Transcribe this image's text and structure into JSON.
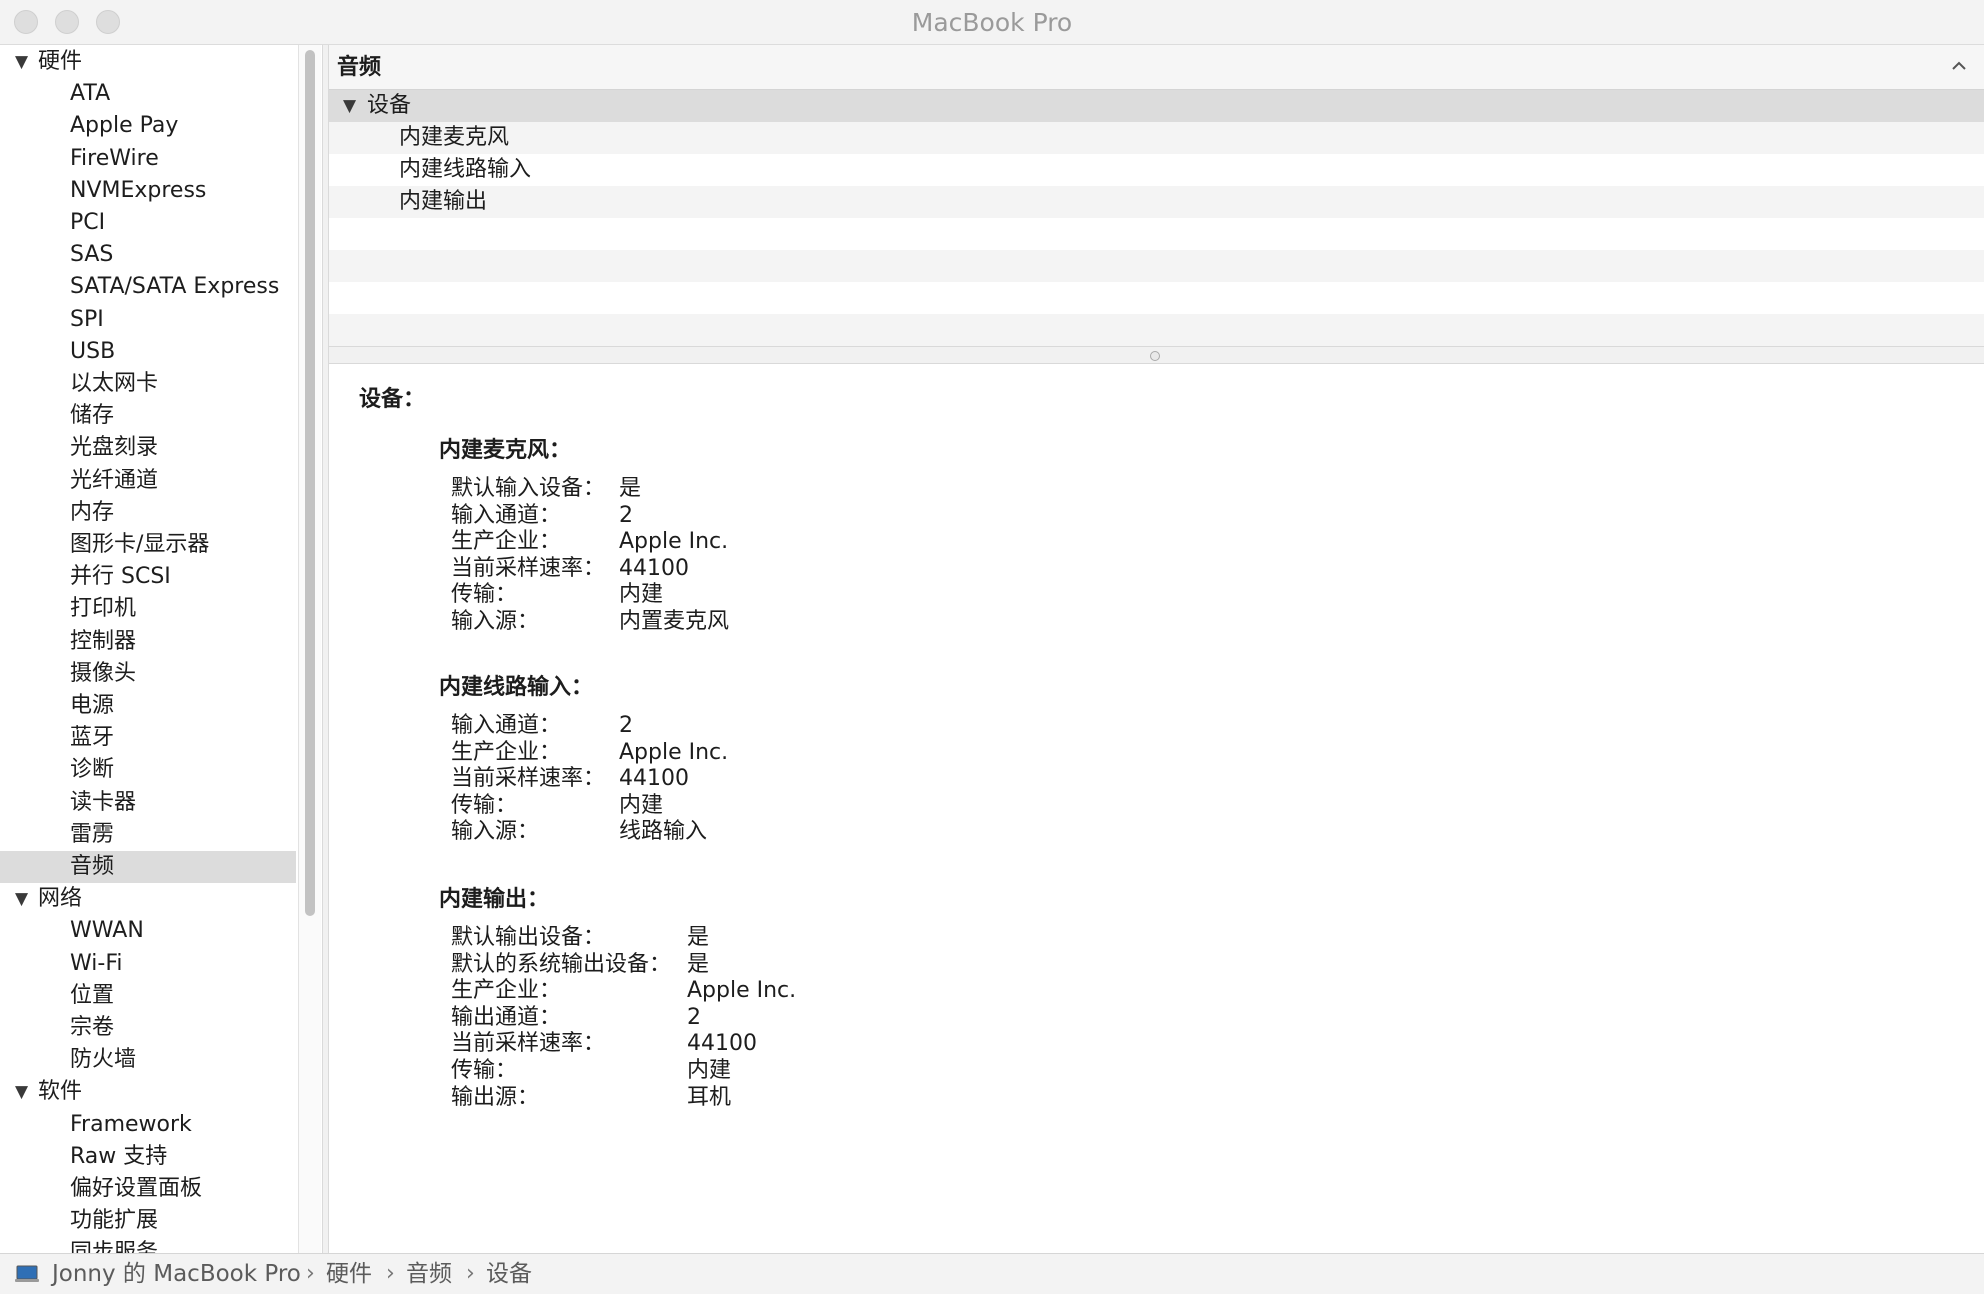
{
  "window": {
    "title": "MacBook Pro"
  },
  "sidebar": {
    "hardware": {
      "label": "硬件",
      "items": [
        "ATA",
        "Apple Pay",
        "FireWire",
        "NVMExpress",
        "PCI",
        "SAS",
        "SATA/SATA Express",
        "SPI",
        "USB",
        "以太网卡",
        "储存",
        "光盘刻录",
        "光纤通道",
        "内存",
        "图形卡/显示器",
        "并行 SCSI",
        "打印机",
        "控制器",
        "摄像头",
        "电源",
        "蓝牙",
        "诊断",
        "读卡器",
        "雷雳",
        "音频"
      ]
    },
    "network": {
      "label": "网络",
      "items": [
        "WWAN",
        "Wi-Fi",
        "位置",
        "宗卷",
        "防火墙"
      ]
    },
    "software": {
      "label": "软件",
      "items": [
        "Framework",
        "Raw 支持",
        "偏好设置面板",
        "功能扩展",
        "同步服务"
      ]
    },
    "selected": "音频"
  },
  "list": {
    "header": "音频",
    "group": "设备",
    "rows": [
      "内建麦克风",
      "内建线路输入",
      "内建输出"
    ]
  },
  "detail": {
    "title": "设备：",
    "devices": [
      {
        "name": "内建麦克风：",
        "props": [
          {
            "k": "默认输入设备：",
            "v": "是"
          },
          {
            "k": "输入通道：",
            "v": "2"
          },
          {
            "k": "生产企业：",
            "v": "Apple Inc."
          },
          {
            "k": "当前采样速率：",
            "v": "44100"
          },
          {
            "k": "传输：",
            "v": "内建"
          },
          {
            "k": "输入源：",
            "v": "内置麦克风"
          }
        ]
      },
      {
        "name": "内建线路输入：",
        "props": [
          {
            "k": "输入通道：",
            "v": "2"
          },
          {
            "k": "生产企业：",
            "v": "Apple Inc."
          },
          {
            "k": "当前采样速率：",
            "v": "44100"
          },
          {
            "k": "传输：",
            "v": "内建"
          },
          {
            "k": "输入源：",
            "v": "线路输入"
          }
        ]
      },
      {
        "name": "内建输出：",
        "props": [
          {
            "k": "默认输出设备：",
            "v": "是"
          },
          {
            "k": "默认的系统输出设备：",
            "v": "是"
          },
          {
            "k": "生产企业：",
            "v": "Apple Inc."
          },
          {
            "k": "输出通道：",
            "v": "2"
          },
          {
            "k": "当前采样速率：",
            "v": "44100"
          },
          {
            "k": "传输：",
            "v": "内建"
          },
          {
            "k": "输出源：",
            "v": "耳机"
          }
        ]
      }
    ]
  },
  "statusbar": {
    "icon": "laptop-icon",
    "path": [
      "Jonny 的 MacBook Pro",
      "硬件",
      "音频",
      "设备"
    ],
    "separator": "›"
  }
}
